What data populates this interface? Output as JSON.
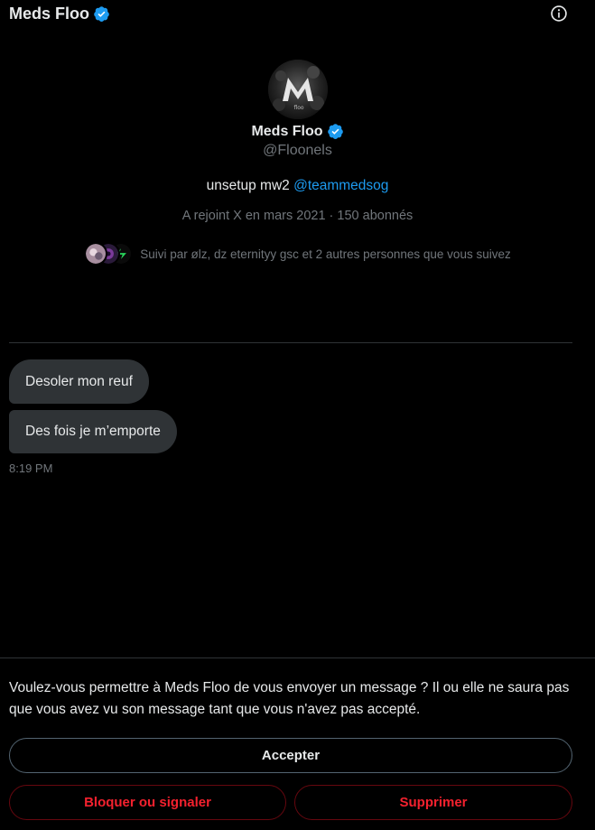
{
  "header": {
    "name": "Meds Floo"
  },
  "profile": {
    "name": "Meds Floo",
    "handle": "@Floonels",
    "bio_text": "unsetup mw2 ",
    "bio_mention": "@teammedsog",
    "meta": "A rejoint X en mars 2021 · 150 abonnés",
    "followed_by": "Suivi par ølz, dz eternityy gsc et 2 autres personnes que vous suivez"
  },
  "messages": [
    {
      "text": "Desoler mon reuf"
    },
    {
      "text": "Des fois je m’emporte"
    }
  ],
  "timestamp": "8:19 PM",
  "request": {
    "text": "Voulez-vous permettre à Meds Floo de vous envoyer un message ? Il ou elle ne saura pas que vous avez vu son message tant que vous n'avez pas accepté.",
    "accept_label": "Accepter",
    "block_label": "Bloquer ou signaler",
    "delete_label": "Supprimer"
  },
  "colors": {
    "verified": "#1d9bf0",
    "danger": "#f4212e",
    "bubble": "#2f3336"
  },
  "icons": {
    "verified": "verified-badge-icon",
    "info": "info-icon"
  }
}
